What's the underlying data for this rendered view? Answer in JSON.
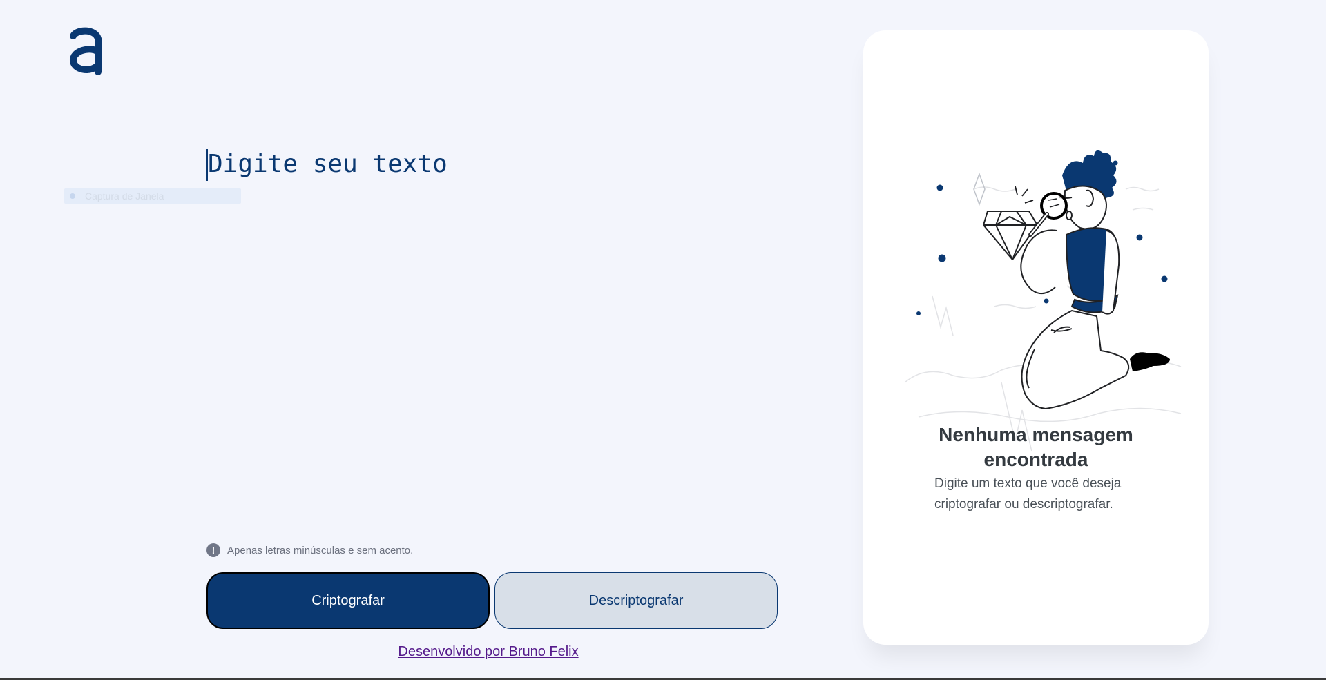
{
  "logo": {
    "icon": "alura-logo-icon",
    "color": "#0a3871"
  },
  "ghost_item": {
    "label": "Captura de Janela"
  },
  "editor": {
    "placeholder": "Digite seu texto"
  },
  "hint": {
    "icon": "exclamation-icon",
    "text": "Apenas letras minúsculas e sem acento."
  },
  "buttons": {
    "encrypt": "Criptografar",
    "decrypt": "Descriptografar"
  },
  "footer": {
    "credit": "Desenvolvido por Bruno Felix"
  },
  "result_panel": {
    "illustration": "person-with-magnifier-illustration",
    "title": "Nenhuma mensagem encontrada",
    "description": "Digite um texto que você deseja criptografar ou descriptografar."
  },
  "colors": {
    "accent": "#0a3871",
    "background": "#f3f5fc",
    "secondary_button": "#d8dfe8"
  }
}
